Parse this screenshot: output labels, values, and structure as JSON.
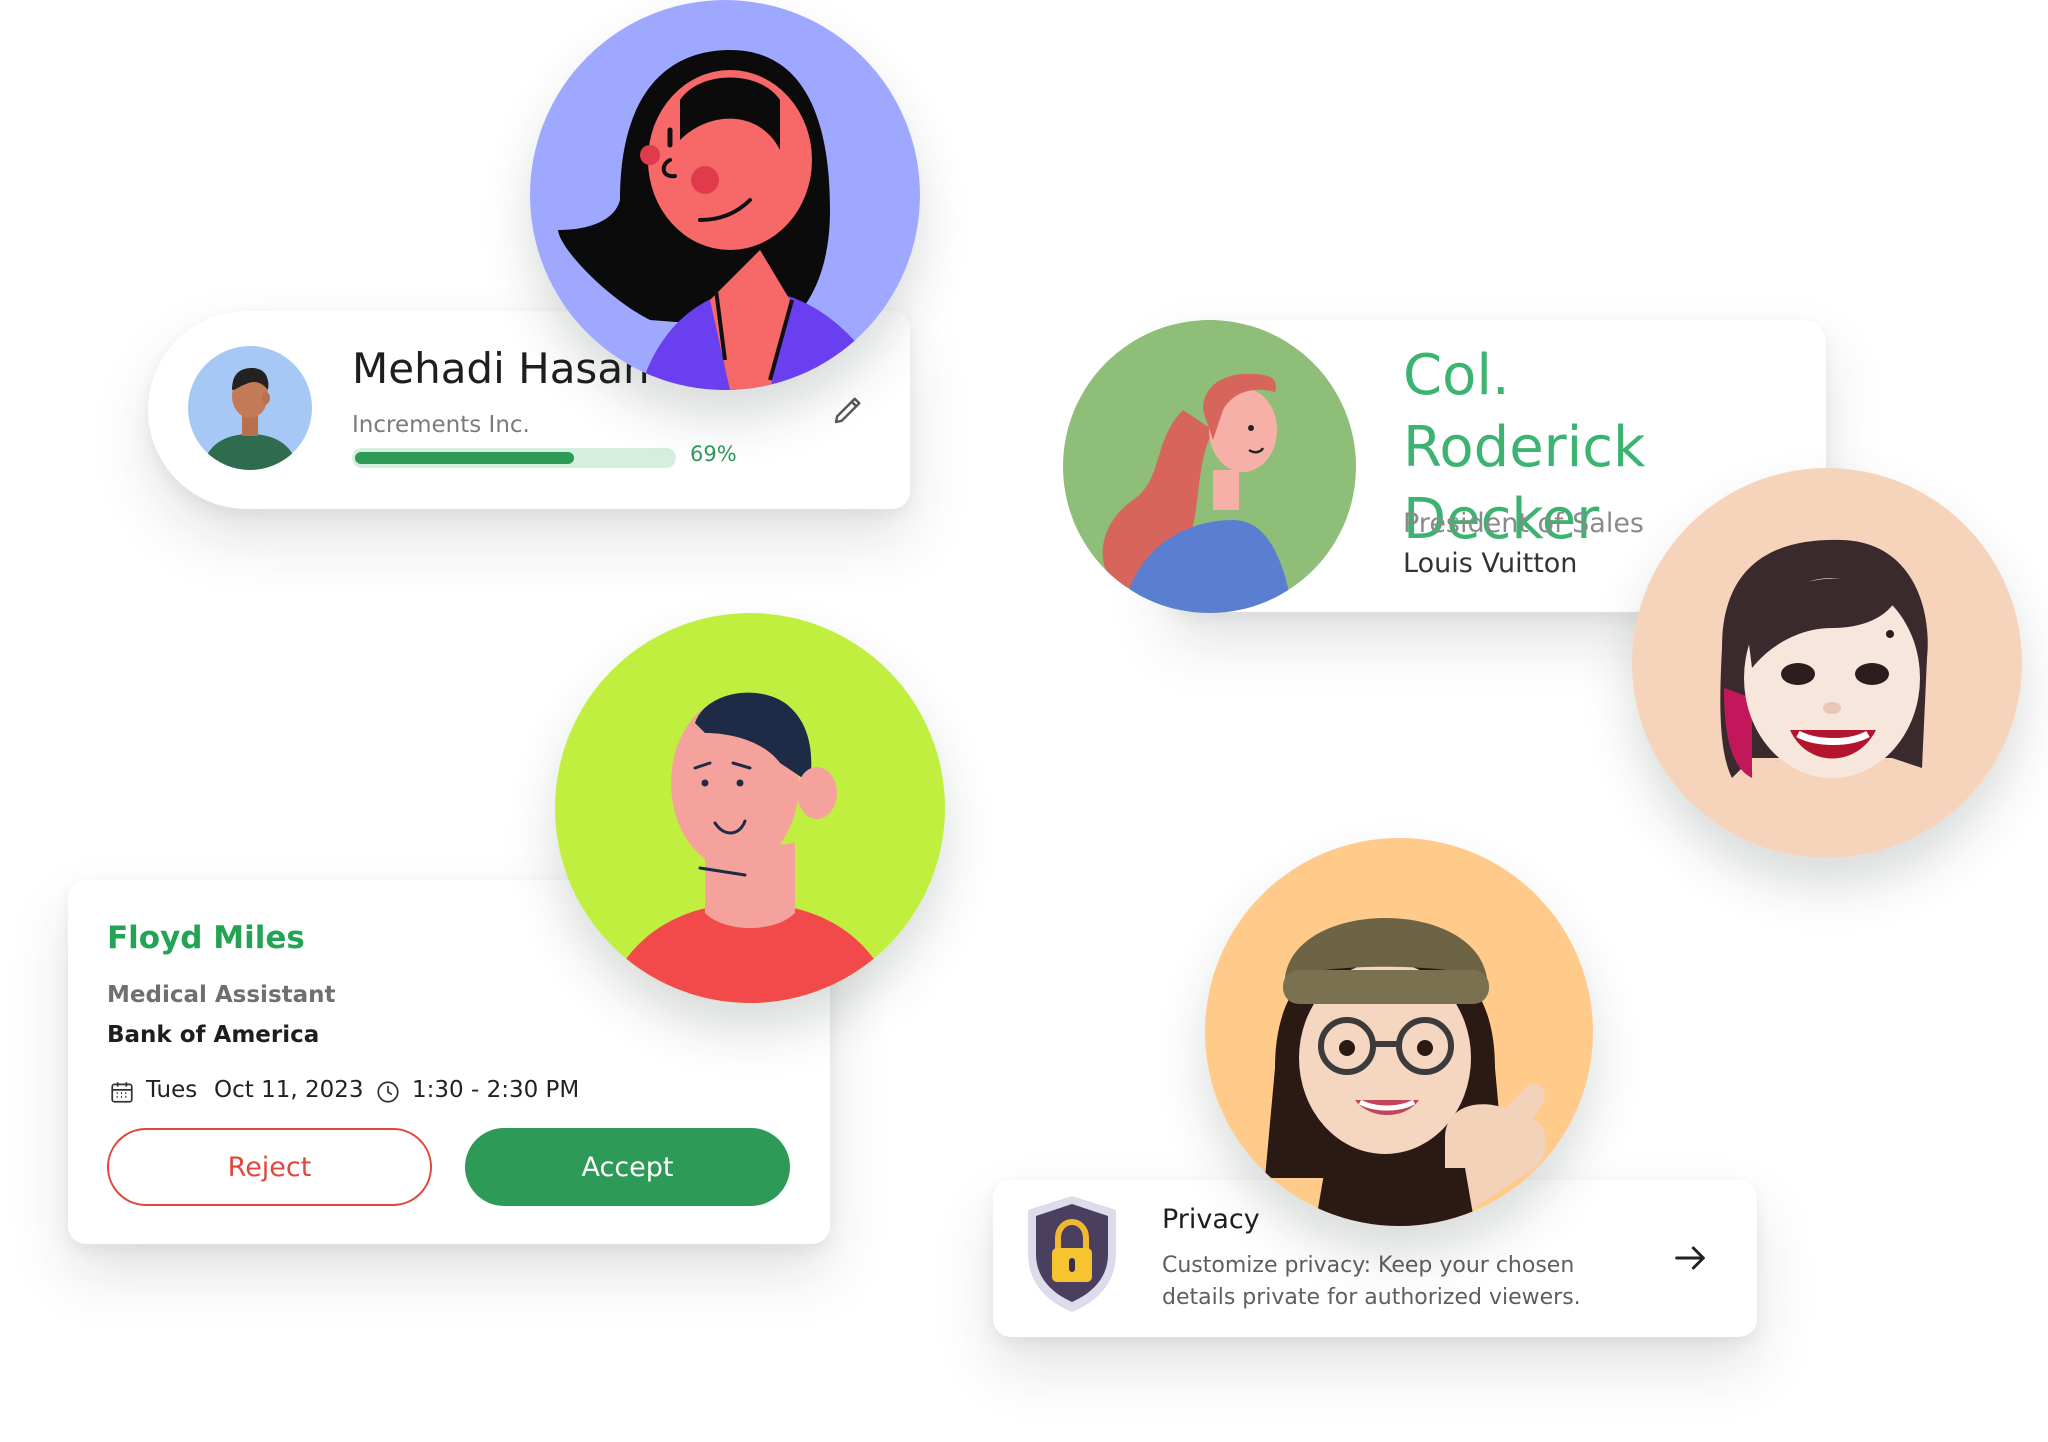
{
  "colors": {
    "accent_green": "#2e9a58",
    "title_green": "#3cb371",
    "reject_red": "#e0473c",
    "avatar_backgrounds": [
      "#9ea8ff",
      "#a7c8f5",
      "#8fbe78",
      "#f6d3bb",
      "#c0ef40",
      "#ffca8a"
    ]
  },
  "profile_card": {
    "name": "Mehadi Hasan",
    "company": "Increments Inc.",
    "progress_percent": 69,
    "progress_label": "69%",
    "edit_icon": "pencil-icon"
  },
  "contact_card": {
    "name": "Col. Roderick Decker",
    "role": "President of Sales",
    "company": "Louis Vuitton"
  },
  "invite_card": {
    "name": "Floyd Miles",
    "role": "Medical Assistant",
    "company": "Bank of America",
    "day": "Tues",
    "date": "Oct 11, 2023",
    "time": "1:30 - 2:30 PM",
    "calendar_icon": "calendar-icon",
    "clock_icon": "clock-icon",
    "reject_label": "Reject",
    "accept_label": "Accept"
  },
  "privacy_card": {
    "title": "Privacy",
    "description": "Customize privacy: Keep your chosen details private for authorized viewers.",
    "icon": "shield-lock-icon",
    "arrow_icon": "arrow-right-icon"
  }
}
